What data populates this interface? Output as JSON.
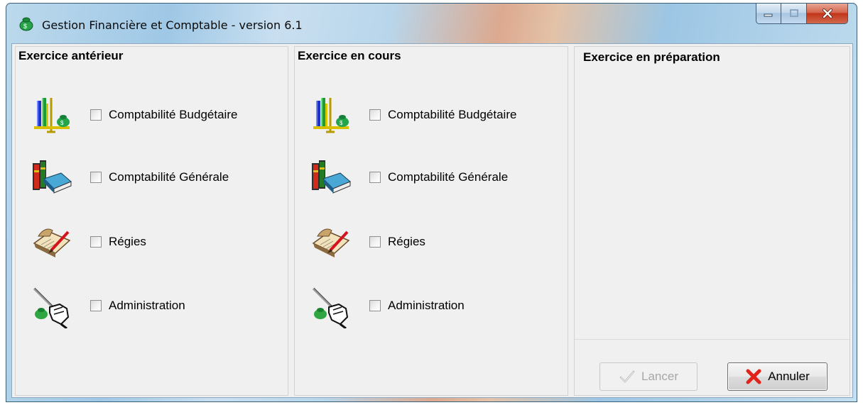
{
  "window": {
    "title": "Gestion Financière et Comptable - version 6.1",
    "controls": {
      "minimize": "minimize",
      "maximize": "maximize",
      "close": "close"
    }
  },
  "panels": [
    {
      "heading": "Exercice antérieur",
      "modules": [
        {
          "label": "Comptabilité Budgétaire",
          "icon": "budget-scale-icon",
          "checked": false
        },
        {
          "label": "Comptabilité Générale",
          "icon": "books-icon",
          "checked": false
        },
        {
          "label": "Régies",
          "icon": "ledger-pen-icon",
          "checked": false
        },
        {
          "label": "Administration",
          "icon": "admin-hand-icon",
          "checked": false
        }
      ]
    },
    {
      "heading": "Exercice en cours",
      "modules": [
        {
          "label": "Comptabilité Budgétaire",
          "icon": "budget-scale-icon",
          "checked": false
        },
        {
          "label": "Comptabilité Générale",
          "icon": "books-icon",
          "checked": false
        },
        {
          "label": "Régies",
          "icon": "ledger-pen-icon",
          "checked": false
        },
        {
          "label": "Administration",
          "icon": "admin-hand-icon",
          "checked": false
        }
      ]
    },
    {
      "heading": "Exercice en préparation",
      "modules": []
    }
  ],
  "buttons": {
    "launch": {
      "label": "Lancer",
      "enabled": false,
      "icon": "checkmark-icon"
    },
    "cancel": {
      "label": "Annuler",
      "enabled": true,
      "icon": "red-x-icon"
    }
  },
  "colors": {
    "dialog_background": "#f0f0f0",
    "close_button": "#c1351b",
    "cancel_icon": "#e2231a",
    "disabled_text": "#a7a7a7"
  }
}
